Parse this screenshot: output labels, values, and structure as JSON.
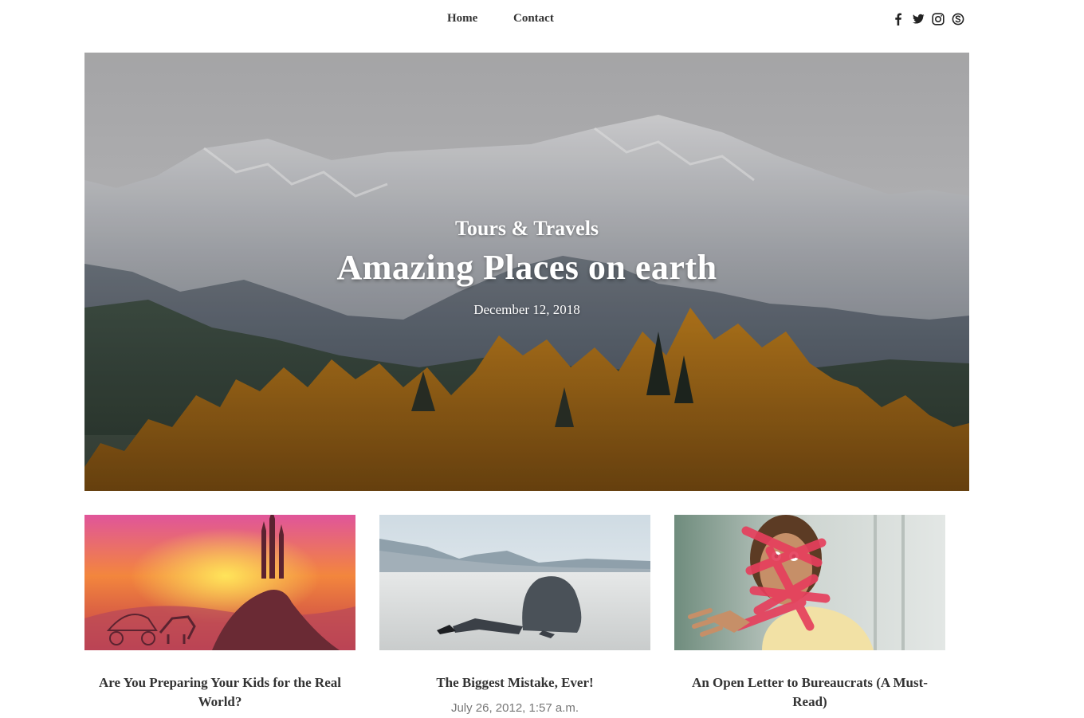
{
  "nav": {
    "items": [
      {
        "label": "Home"
      },
      {
        "label": "Contact"
      }
    ],
    "social_icons": [
      "facebook-icon",
      "twitter-icon",
      "instagram-icon",
      "skype-icon"
    ]
  },
  "hero": {
    "category": "Tours & Travels",
    "title": "Amazing Places on earth",
    "date": "December 12, 2018"
  },
  "posts": [
    {
      "title": "Are You Preparing Your Kids for the Real World?",
      "date": ""
    },
    {
      "title": "The Biggest Mistake, Ever!",
      "date": "July 26, 2012, 1:57 a.m."
    },
    {
      "title": "An Open Letter to Bureaucrats (A Must-Read)",
      "date": ""
    }
  ],
  "colors": {
    "text": "#333333",
    "muted": "#777777",
    "background": "#ffffff",
    "hero_text": "#ffffff"
  }
}
